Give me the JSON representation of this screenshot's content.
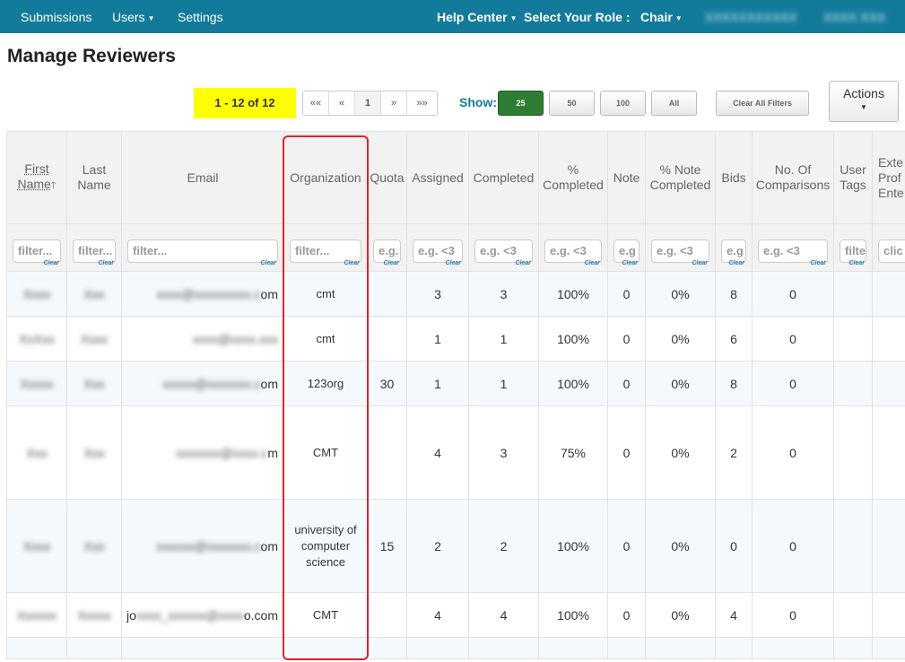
{
  "nav": {
    "submissions": "Submissions",
    "users": "Users",
    "settings": "Settings",
    "help_center": "Help Center",
    "select_role": "Select Your Role :",
    "role": "Chair",
    "user_blur_a": "XXXXXXXXXXX",
    "user_blur_b": "XXXX XXX"
  },
  "page_title": "Manage Reviewers",
  "pager": {
    "range": "1 - 12 of 12",
    "first": "««",
    "prev": "«",
    "page": "1",
    "next": "»",
    "last": "»»"
  },
  "show": {
    "label": "Show:",
    "options": [
      "25",
      "50",
      "100",
      "All"
    ]
  },
  "clear_all_filters": "Clear All Filters",
  "actions_label": "Actions",
  "columns": {
    "first": "First",
    "name": "Name",
    "last": "Last",
    "last_name": "Name",
    "email": "Email",
    "organization": "Organization",
    "quota": "Quota",
    "assigned": "Assigned",
    "completed": "Completed",
    "pct": "%",
    "pct_completed": "Completed",
    "note": "Note",
    "pct_note": "% Note",
    "pct_note_completed": "Completed",
    "bids": "Bids",
    "no_of": "No. Of",
    "comparisons": "Comparisons",
    "user": "User",
    "tags": "Tags",
    "ext1": "Exte",
    "ext2": "Prof",
    "ext3": "Ente"
  },
  "filters": {
    "first": "filter...",
    "last": "filter...",
    "email": "filter...",
    "organization": "filter...",
    "quota": "e.g.",
    "assigned": "e.g. <3",
    "completed": "e.g. <3",
    "pct_completed": "e.g. <3",
    "note": "e.g",
    "pct_note": "e.g. <3",
    "bids": "e.g",
    "comparisons": "e.g. <3",
    "tags": "filte",
    "ext": "clic",
    "clear": "Clear"
  },
  "rows": [
    {
      "first": "Xxxx",
      "last": "Xxx",
      "email_blur": "xxxx@xxxxxxxxx.c",
      "email_end": "om",
      "org": "cmt",
      "quota": "",
      "assigned": "3",
      "completed": "3",
      "pct": "100%",
      "note": "0",
      "pct_note": "0%",
      "bids": "8",
      "comparisons": "0"
    },
    {
      "first": "XxXxx",
      "last": "Xxxx",
      "email_blur": "xxxx@xxxx.xxx",
      "email_end": "",
      "org": "cmt",
      "quota": "",
      "assigned": "1",
      "completed": "1",
      "pct": "100%",
      "note": "0",
      "pct_note": "0%",
      "bids": "6",
      "comparisons": "0"
    },
    {
      "first": "Xxxxx",
      "last": "Xxx",
      "email_blur": "xxxxx@xxxxxxx.c",
      "email_end": "om",
      "org": "123org",
      "quota": "30",
      "assigned": "1",
      "completed": "1",
      "pct": "100%",
      "note": "0",
      "pct_note": "0%",
      "bids": "8",
      "comparisons": "0"
    },
    {
      "first": "Xxx",
      "last": "Xxx",
      "email_blur": "xxxxxxx@xxxx.c",
      "email_end": "m",
      "org": "CMT",
      "quota": "",
      "assigned": "4",
      "completed": "3",
      "pct": "75%",
      "note": "0",
      "pct_note": "0%",
      "bids": "2",
      "comparisons": "0"
    },
    {
      "first": "Xxxx",
      "last": "Xxx",
      "email_blur": "xxxxxx@xxxxxxx.c",
      "email_end": "om",
      "org": "university of computer science",
      "quota": "15",
      "assigned": "2",
      "completed": "2",
      "pct": "100%",
      "note": "0",
      "pct_note": "0%",
      "bids": "0",
      "comparisons": "0"
    },
    {
      "first": "Xxxxxx",
      "last": "Xxxxx",
      "email_pre": "jo",
      "email_blur": "xxxx_xxxxxx@xxxx",
      "email_end": "o.com",
      "org": "CMT",
      "quota": "",
      "assigned": "4",
      "completed": "4",
      "pct": "100%",
      "note": "0",
      "pct_note": "0%",
      "bids": "4",
      "comparisons": "0"
    }
  ]
}
